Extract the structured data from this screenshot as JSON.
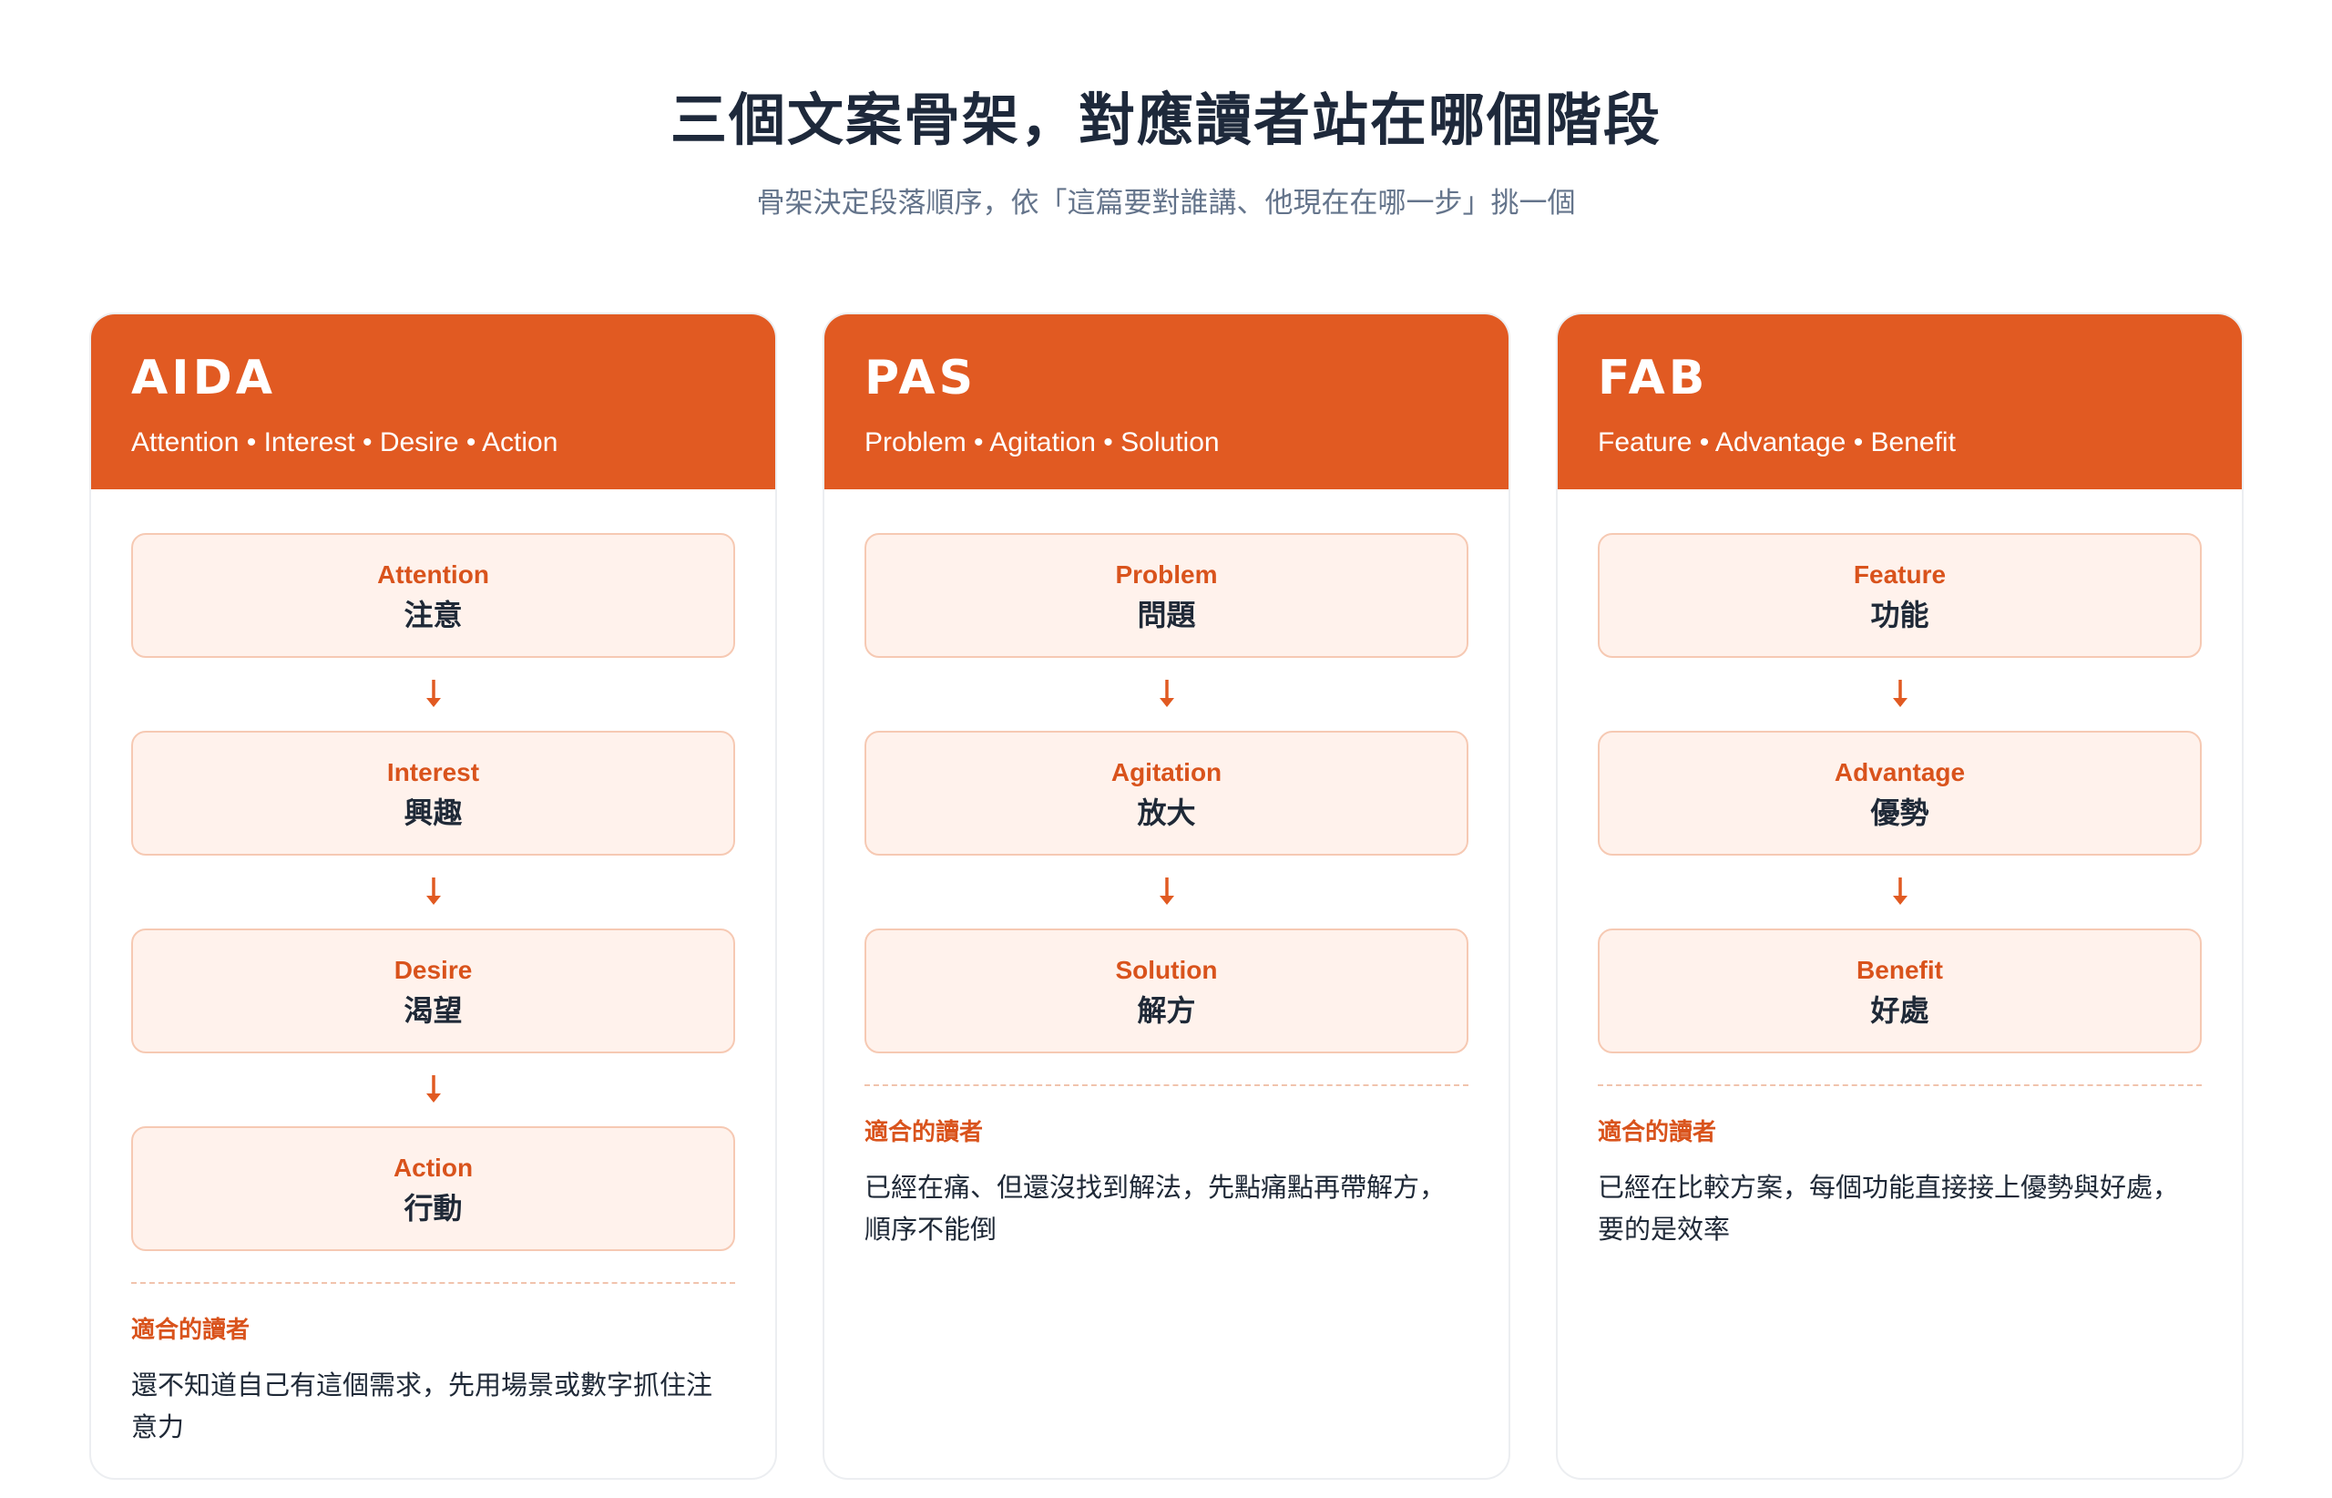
{
  "header": {
    "title": "三個文案骨架，對應讀者站在哪個階段",
    "subtitle": "骨架決定段落順序，依「這篇要對誰講、他現在在哪一步」挑一個"
  },
  "colors": {
    "accent": "#e15a22",
    "step_bg": "#fff2ec",
    "step_border": "#f6c9b3",
    "label": "#d9531c"
  },
  "cards": [
    {
      "title": "AIDA",
      "desc": "Attention • Interest • Desire • Action",
      "steps": [
        {
          "en": "Attention",
          "zh": "注意"
        },
        {
          "en": "Interest",
          "zh": "興趣"
        },
        {
          "en": "Desire",
          "zh": "渴望"
        },
        {
          "en": "Action",
          "zh": "行動"
        }
      ],
      "fit_label": "適合的讀者",
      "fit_text": "還不知道自己有這個需求，先用場景或數字抓住注意力"
    },
    {
      "title": "PAS",
      "desc": "Problem • Agitation • Solution",
      "steps": [
        {
          "en": "Problem",
          "zh": "問題"
        },
        {
          "en": "Agitation",
          "zh": "放大"
        },
        {
          "en": "Solution",
          "zh": "解方"
        }
      ],
      "fit_label": "適合的讀者",
      "fit_text": "已經在痛、但還沒找到解法，先點痛點再帶解方，順序不能倒"
    },
    {
      "title": "FAB",
      "desc": "Feature • Advantage • Benefit",
      "steps": [
        {
          "en": "Feature",
          "zh": "功能"
        },
        {
          "en": "Advantage",
          "zh": "優勢"
        },
        {
          "en": "Benefit",
          "zh": "好處"
        }
      ],
      "fit_label": "適合的讀者",
      "fit_text": "已經在比較方案，每個功能直接接上優勢與好處，要的是效率"
    }
  ],
  "icons": {
    "arrow": "arrow-down-icon"
  }
}
